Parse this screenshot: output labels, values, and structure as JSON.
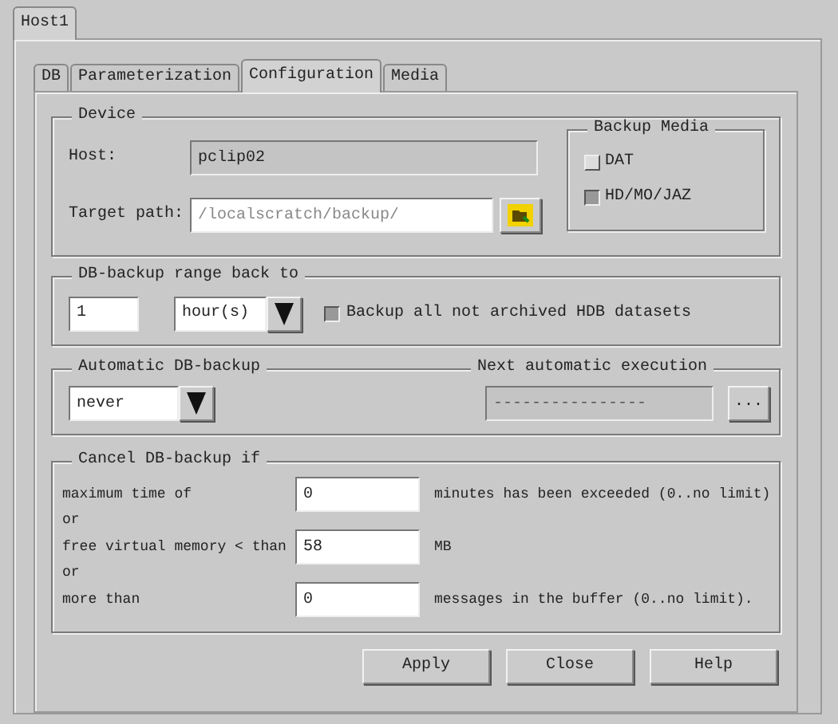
{
  "outer_tabs": [
    {
      "label": "Host1",
      "selected": true
    }
  ],
  "tabs": [
    {
      "label": "DB",
      "selected": false
    },
    {
      "label": "Parameterization",
      "selected": false
    },
    {
      "label": "Configuration",
      "selected": true
    },
    {
      "label": "Media",
      "selected": false
    }
  ],
  "device": {
    "title": "Device",
    "host_label": "Host:",
    "host_value": "pclip02",
    "target_label": "Target path:",
    "target_value": "/localscratch/backup/",
    "backup_media": {
      "title": "Backup Media",
      "options": [
        {
          "label": "DAT",
          "selected": false
        },
        {
          "label": "HD/MO/JAZ",
          "selected": true
        }
      ]
    }
  },
  "range": {
    "title": "DB-backup range back to",
    "value": "1",
    "unit": "hour(s)",
    "checkbox": {
      "label": "Backup all not archived HDB datasets",
      "checked": true
    }
  },
  "automatic": {
    "title": "Automatic DB-backup",
    "value": "never",
    "next_title": "Next automatic execution",
    "next_value": "----------------",
    "browse": "..."
  },
  "cancel": {
    "title": "Cancel DB-backup if",
    "rows": [
      {
        "kind": "field",
        "label": "maximum time of",
        "value": "0",
        "suffix": "minutes has been exceeded (0..no limit)"
      },
      {
        "kind": "text",
        "label": "or"
      },
      {
        "kind": "field",
        "label": "free virtual memory < than",
        "value": "58",
        "suffix": "MB"
      },
      {
        "kind": "text",
        "label": "or"
      },
      {
        "kind": "field",
        "label": "more than",
        "value": "0",
        "suffix": "messages in the buffer (0..no limit)."
      }
    ]
  },
  "buttons": [
    "Apply",
    "Close",
    "Help"
  ]
}
